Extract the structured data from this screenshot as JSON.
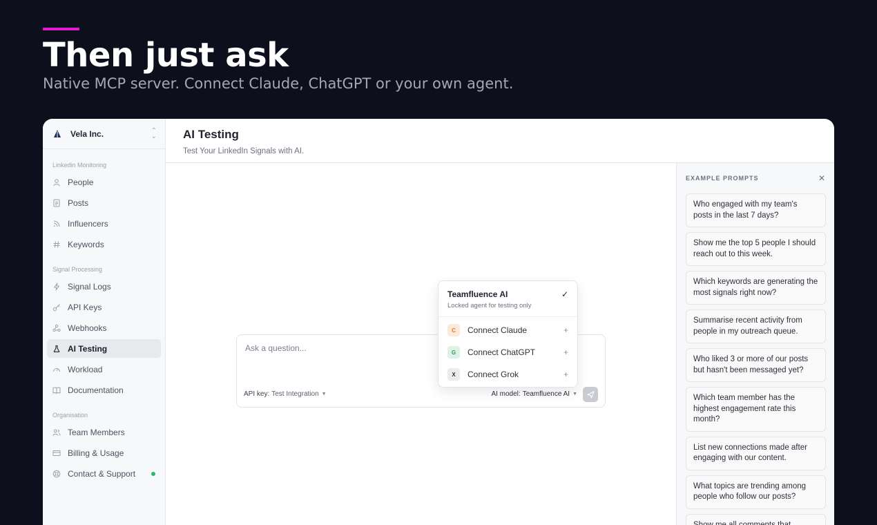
{
  "hero": {
    "title": "Then just ask",
    "subtitle": "Native MCP server. Connect Claude, ChatGPT or your own agent."
  },
  "colors": {
    "accent": "#e31ccf",
    "background": "#0d0f1c",
    "status_online": "#2bb673"
  },
  "org": {
    "name": "Vela Inc.",
    "logo_icon": "sail-logo-icon",
    "switch_icon": "chevron-updown-icon"
  },
  "sidebar": {
    "sections": [
      {
        "label": "Linkedin Monitoring",
        "items": [
          {
            "label": "People",
            "icon": "user-icon"
          },
          {
            "label": "Posts",
            "icon": "document-icon"
          },
          {
            "label": "Influencers",
            "icon": "rss-icon"
          },
          {
            "label": "Keywords",
            "icon": "hash-icon"
          }
        ]
      },
      {
        "label": "Signal Processing",
        "items": [
          {
            "label": "Signal Logs",
            "icon": "bolt-icon"
          },
          {
            "label": "API Keys",
            "icon": "key-icon"
          },
          {
            "label": "Webhooks",
            "icon": "webhook-icon"
          },
          {
            "label": "AI Testing",
            "icon": "flask-icon",
            "active": true
          },
          {
            "label": "Workload",
            "icon": "gauge-icon"
          },
          {
            "label": "Documentation",
            "icon": "book-icon"
          }
        ]
      },
      {
        "label": "Organisation",
        "items": [
          {
            "label": "Team Members",
            "icon": "users-icon"
          },
          {
            "label": "Billing & Usage",
            "icon": "credit-card-icon"
          },
          {
            "label": "Contact & Support",
            "icon": "support-icon",
            "status": "online"
          }
        ]
      }
    ]
  },
  "header": {
    "title": "AI Testing",
    "subtitle": "Test Your LinkedIn Signals with AI."
  },
  "composer": {
    "placeholder": "Ask a question...",
    "api_key_label": "API key:",
    "api_key_value": "Test Integration",
    "model_label": "AI model:",
    "model_value": "Teamfluence AI"
  },
  "model_dropdown": {
    "selected_title": "Teamfluence AI",
    "selected_subtitle": "Locked agent for testing only",
    "options": [
      {
        "badge": "C",
        "label": "Connect Claude",
        "badge_bg": "#fde9d8",
        "badge_color": "#d9772b"
      },
      {
        "badge": "G",
        "label": "Connect ChatGPT",
        "badge_bg": "#dcf3e6",
        "badge_color": "#2a9a5f"
      },
      {
        "badge": "X",
        "label": "Connect Grok",
        "badge_bg": "#ececef",
        "badge_color": "#2b2f3a"
      }
    ]
  },
  "prompts": {
    "title": "EXAMPLE PROMPTS",
    "items": [
      "Who engaged with my team's posts in the last 7 days?",
      "Show me the top 5 people I should reach out to this week.",
      "Which keywords are generating the most signals right now?",
      "Summarise recent activity from people in my outreach queue.",
      "Who liked 3 or more of our posts but hasn't been messaged yet?",
      "Which team member has the highest engagement rate this month?",
      "List new connections made after engaging with our content.",
      "What topics are trending among people who follow our posts?",
      "Show me all comments that mention pricing or a competitor."
    ]
  }
}
